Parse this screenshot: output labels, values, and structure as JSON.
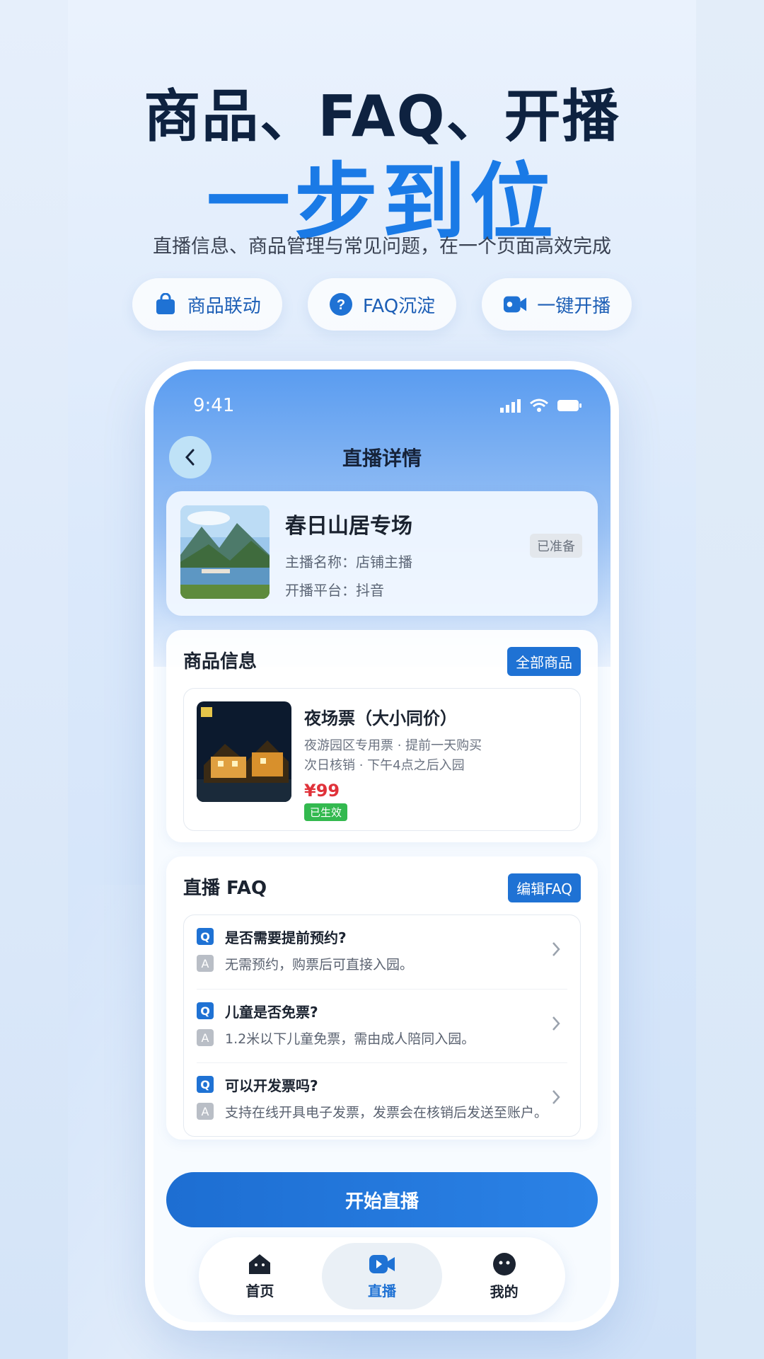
{
  "hero": {
    "title": "商品、FAQ、开播",
    "title_big": "一步到位",
    "subtitle": "直播信息、商品管理与常见问题，在一个页面高效完成"
  },
  "chips": [
    {
      "label": "商品联动",
      "icon": "shopping-bag-icon"
    },
    {
      "label": "FAQ沉淀",
      "icon": "question-circle-icon"
    },
    {
      "label": "一键开播",
      "icon": "video-camera-icon"
    }
  ],
  "phone": {
    "status_time": "9:41",
    "nav_title": "直播详情",
    "live": {
      "title": "春日山居专场",
      "anchor": "主播名称：店铺主播",
      "platform": "开播平台：抖音",
      "status": "已准备"
    },
    "goods": {
      "section_title": "商品信息",
      "all_button": "全部商品",
      "item": {
        "title": "夜场票（大小同价）",
        "desc1": "夜游园区专用票 · 提前一天购买",
        "desc2": "次日核销 · 下午4点之后入园",
        "price": "¥99",
        "badge": "已生效"
      }
    },
    "faq": {
      "section_title": "直播 FAQ",
      "edit_button": "编辑FAQ",
      "q_tag": "Q",
      "a_tag": "A",
      "items": [
        {
          "q": "是否需要提前预约?",
          "a": "无需预约，购票后可直接入园。"
        },
        {
          "q": "儿童是否免票?",
          "a": "1.2米以下儿童免票，需由成人陪同入园。"
        },
        {
          "q": "可以开发票吗?",
          "a": "支持在线开具电子发票，发票会在核销后发送至账户。"
        }
      ]
    },
    "start_button": "开始直播",
    "tabs": [
      {
        "label": "首页",
        "icon": "home-icon"
      },
      {
        "label": "直播",
        "icon": "live-icon"
      },
      {
        "label": "我的",
        "icon": "profile-icon"
      }
    ]
  },
  "colors": {
    "accent": "#1f72d4",
    "price": "#e0323a",
    "success": "#33b94f"
  }
}
